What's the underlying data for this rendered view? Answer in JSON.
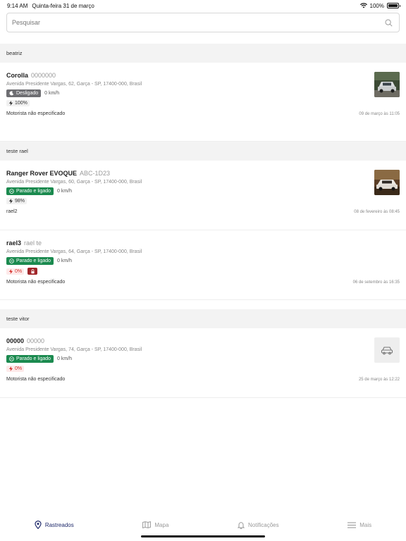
{
  "status_bar": {
    "time": "9:14 AM",
    "date": "Quinta-feira 31 de março",
    "battery": "100%"
  },
  "search": {
    "placeholder": "Pesquisar"
  },
  "groups": [
    {
      "name": "beatriz",
      "vehicles": [
        {
          "name": "Corolla",
          "plate": "0000000",
          "address": "Avenida Presidente Vargas, 62, Garça - SP, 17400-000, Brasil",
          "status": "Desligado",
          "speed": "0 km/h",
          "battery": "100%",
          "driver": "Motorista não especificado",
          "timestamp": "09 de março às 11:05"
        }
      ]
    },
    {
      "name": "teste rael",
      "vehicles": [
        {
          "name": "Ranger Rover EVOQUE",
          "plate": "ABC-1D23",
          "address": "Avenida Presidente Vargas, 60, Garça - SP, 17400-000, Brasil",
          "status": "Parado e ligado",
          "speed": "0 km/h",
          "battery": "98%",
          "driver": "rael2",
          "timestamp": "08 de fevereiro às 08:45"
        },
        {
          "name": "rael3",
          "plate": "rael te",
          "address": "Avenida Presidente Vargas, 64, Garça - SP, 17400-000, Brasil",
          "status": "Parado e ligado",
          "speed": "0 km/h",
          "battery": "0%",
          "driver": "Motorista não especificado",
          "timestamp": "06 de setembro às 16:35"
        }
      ]
    },
    {
      "name": "teste vitor",
      "vehicles": [
        {
          "name": "00000",
          "plate": "00000",
          "address": "Avenida Presidente Vargas, 74, Garça - SP, 17400-000, Brasil",
          "status": "Parado e ligado",
          "speed": "0 km/h",
          "battery": "0%",
          "driver": "Motorista não especificado",
          "timestamp": "25 de março às 12:22"
        }
      ]
    }
  ],
  "tabs": [
    {
      "label": "Rastreados",
      "icon": "map-pin-icon"
    },
    {
      "label": "Mapa",
      "icon": "map-icon"
    },
    {
      "label": "Notificações",
      "icon": "bell-icon"
    },
    {
      "label": "Mais",
      "icon": "menu-icon"
    }
  ],
  "colors": {
    "accent": "#1f2a6b",
    "status_on": "#1b8a4f",
    "status_off": "#6e6e72",
    "alert": "#d6322d",
    "lock": "#a0262a"
  }
}
